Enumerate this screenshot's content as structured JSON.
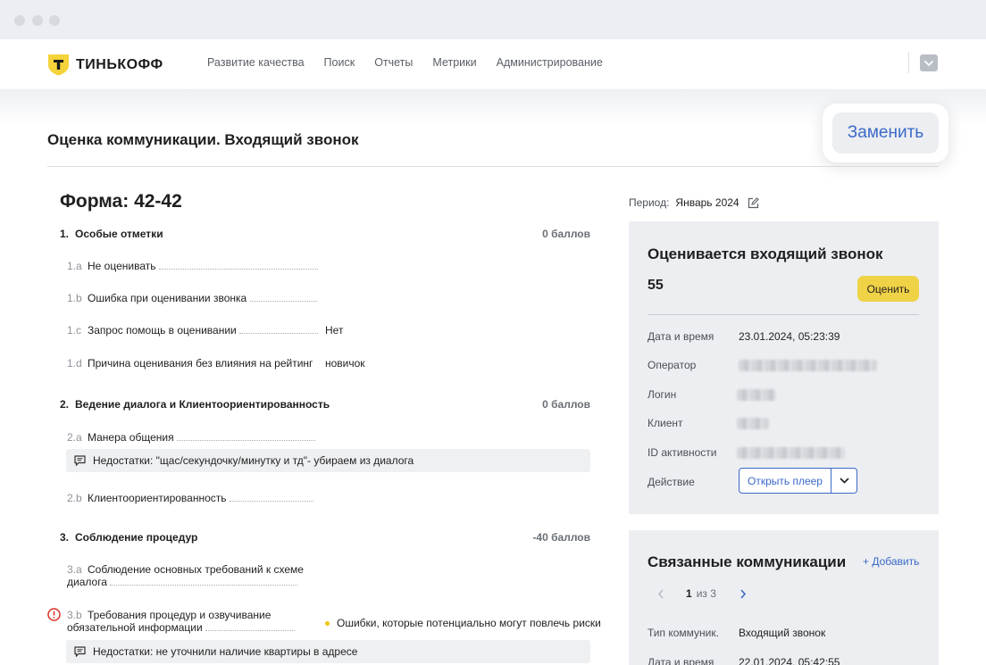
{
  "nav": {
    "brand": "ТИНЬКОФФ",
    "items": [
      "Развитие качества",
      "Поиск",
      "Отчеты",
      "Метрики",
      "Администрирование"
    ]
  },
  "page": {
    "title": "Оценка коммуникации. Входящий звонок",
    "replace_button": "Заменить"
  },
  "form": {
    "title": "Форма: 42-42",
    "sections": [
      {
        "num": "1.",
        "title": "Особые отметки",
        "score": "0 баллов"
      },
      {
        "num": "2.",
        "title": "Ведение диалога и Клиентоориентированность",
        "score": "0 баллов"
      },
      {
        "num": "3.",
        "title": "Соблюдение процедур",
        "score": "-40 баллов"
      }
    ],
    "items": [
      {
        "code": "1.a",
        "label": "Не оценивать",
        "value": ""
      },
      {
        "code": "1.b",
        "label": "Ошибка при оценивании звонка",
        "value": ""
      },
      {
        "code": "1.c",
        "label": "Запрос помощь в оценивании",
        "value": "Нет"
      },
      {
        "code": "1.d",
        "label": "Причина оценивания без влияния на рейтинг",
        "value": "новичок"
      },
      {
        "code": "2.a",
        "label": "Манера общения",
        "value": ""
      },
      {
        "code": "2.b",
        "label": "Клиентоориентированность",
        "value": ""
      },
      {
        "code": "3.a",
        "label": "Соблюдение основных требований к схеме диалога",
        "value": ""
      },
      {
        "code": "3.b",
        "label": "Требования процедур и озвучивание обязательной информации",
        "value": "Ошибки, которые потенциально могут повлечь риски"
      }
    ],
    "comments": [
      "Недостатки: \"щас/секундочку/минутку и тд\"- убираем из диалога",
      "Недостатки: не уточнили наличие квартиры в адресе"
    ]
  },
  "period": {
    "label": "Период:",
    "value": "Январь 2024"
  },
  "call_card": {
    "title": "Оценивается входящий звонок",
    "score": "55",
    "rate_button": "Оценить",
    "rows": [
      {
        "key": "Дата и время",
        "value": "23.01.2024, 05:23:39"
      },
      {
        "key": "Оператор",
        "value": ""
      },
      {
        "key": "Логин",
        "value": ""
      },
      {
        "key": "Клиент",
        "value": ""
      },
      {
        "key": "ID активности",
        "value": ""
      },
      {
        "key": "Действие",
        "value": ""
      }
    ],
    "player_button": "Открыть плеер"
  },
  "related": {
    "title": "Связанные коммуникации",
    "add_link": "+ Добавить",
    "page_current": "1",
    "page_total": "из 3",
    "rows": [
      {
        "key": "Тип коммуник.",
        "value": "Входящий звонок"
      },
      {
        "key": "Дата и время",
        "value": "22.01.2024, 05:42:55"
      }
    ]
  },
  "colors": {
    "accent": "#3b6ac8",
    "brand_yellow": "#f0d247",
    "error": "#d93025"
  }
}
